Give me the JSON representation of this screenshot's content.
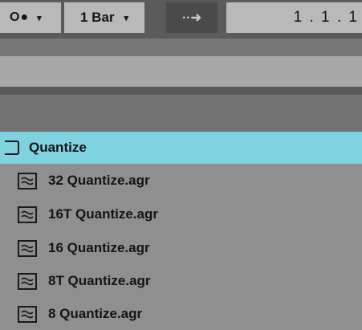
{
  "toolbar": {
    "record_mode": "O●",
    "record_caret": "▾",
    "quantization": "1 Bar",
    "quantization_caret": "▾",
    "follow_icon": "follow-arrow-icon",
    "follow_glyph": "··➜",
    "song_position": "1 .  1 .  1"
  },
  "browser": {
    "folder": {
      "label": "Quantize",
      "icon": "folder-icon"
    },
    "files": [
      {
        "label": "32 Quantize.agr",
        "icon": "groove-file-icon"
      },
      {
        "label": "16T Quantize.agr",
        "icon": "groove-file-icon"
      },
      {
        "label": "16 Quantize.agr",
        "icon": "groove-file-icon"
      },
      {
        "label": "8T Quantize.agr",
        "icon": "groove-file-icon"
      },
      {
        "label": "8 Quantize.agr",
        "icon": "groove-file-icon"
      }
    ]
  },
  "colors": {
    "selected_row": "#7fd2df",
    "panel": "#8f8f8f",
    "toolbar": "#5b5b5b",
    "field": "#b9b9b9"
  }
}
